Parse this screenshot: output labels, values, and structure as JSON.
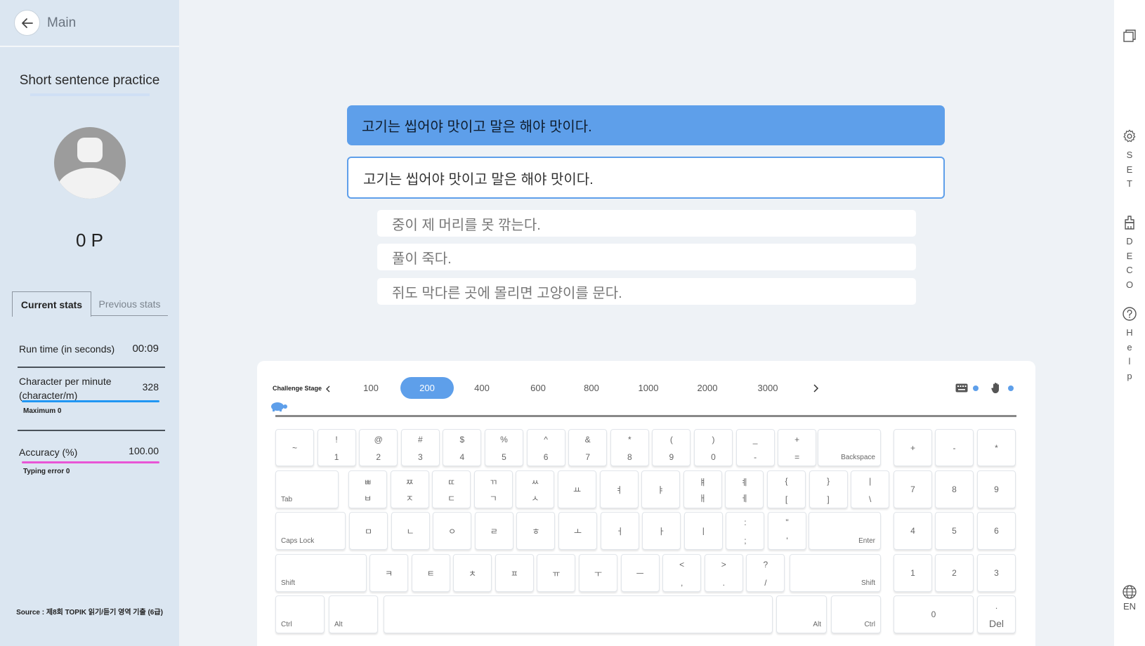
{
  "header": {
    "back_label": "Main"
  },
  "mode": {
    "title": "Short sentence practice"
  },
  "user": {
    "points": "0 P"
  },
  "stats": {
    "tabs": [
      "Current stats",
      "Previous stats"
    ],
    "run_time_label": "Run time (in seconds)",
    "run_time_value": "00:09",
    "cpm_label": "Character per minute (character/m)",
    "cpm_value": "328",
    "cpm_max": "Maximum 0",
    "cpm_color": "#2196f3",
    "accuracy_label": "Accuracy (%)",
    "accuracy_value": "100.00",
    "accuracy_error": "Typing error 0",
    "accuracy_color": "#e855d6"
  },
  "source": {
    "text": "Source : 제8회 TOPIK 읽기/듣기 영역 기출 (6급)"
  },
  "right_menu": {
    "set_letters": "S\nE\nT",
    "deco_letters": "D\nE\nC\nO",
    "help_letters": "H\ne\nl\np",
    "lang": "EN"
  },
  "sentences": {
    "current": "고기는 씹어야 맛이고 말은 해야 맛이다.",
    "typed": "고기는 씹어야 맛이고 말은 해야 맛이다.",
    "next": [
      "중이 제 머리를 못 깎는다.",
      "풀이 죽다.",
      "쥐도 막다른 곳에 몰리면 고양이를 문다."
    ]
  },
  "stage": {
    "label": "Challenge Stage",
    "options": [
      "100",
      "200",
      "400",
      "600",
      "800",
      "1000",
      "2000",
      "3000"
    ],
    "selected": "200"
  },
  "keyboard": {
    "row1": [
      [
        "~",
        ""
      ],
      [
        "!",
        "1"
      ],
      [
        "@",
        "2"
      ],
      [
        "#",
        "3"
      ],
      [
        "$",
        "4"
      ],
      [
        "%",
        "5"
      ],
      [
        "^",
        "6"
      ],
      [
        "&",
        "7"
      ],
      [
        "*",
        "8"
      ],
      [
        "(",
        "9"
      ],
      [
        ")",
        "0"
      ],
      [
        "_",
        "-"
      ],
      [
        "+",
        "="
      ]
    ],
    "backspace": "Backspace",
    "tab": "Tab",
    "row2": [
      [
        "ㅃ",
        "ㅂ"
      ],
      [
        "ㅉ",
        "ㅈ"
      ],
      [
        "ㄸ",
        "ㄷ"
      ],
      [
        "ㄲ",
        "ㄱ"
      ],
      [
        "ㅆ",
        "ㅅ"
      ],
      [
        "",
        "ㅛ"
      ],
      [
        "",
        "ㅕ"
      ],
      [
        "",
        "ㅑ"
      ],
      [
        "ㅒ",
        "ㅐ"
      ],
      [
        "ㅖ",
        "ㅔ"
      ],
      [
        "{",
        "["
      ],
      [
        "}",
        "]"
      ],
      [
        "|",
        "\\"
      ]
    ],
    "caps": "Caps Lock",
    "row3": [
      [
        "",
        "ㅁ"
      ],
      [
        "",
        "ㄴ"
      ],
      [
        "",
        "ㅇ"
      ],
      [
        "",
        "ㄹ"
      ],
      [
        "",
        "ㅎ"
      ],
      [
        "",
        "ㅗ"
      ],
      [
        "",
        "ㅓ"
      ],
      [
        "",
        "ㅏ"
      ],
      [
        "",
        "ㅣ"
      ],
      [
        ":",
        ";"
      ],
      [
        "\"",
        "'"
      ]
    ],
    "enter": "Enter",
    "shift": "Shift",
    "row4": [
      [
        "",
        "ㅋ"
      ],
      [
        "",
        "ㅌ"
      ],
      [
        "",
        "ㅊ"
      ],
      [
        "",
        "ㅍ"
      ],
      [
        "",
        "ㅠ"
      ],
      [
        "",
        "ㅜ"
      ],
      [
        "",
        "ㅡ"
      ],
      [
        "<",
        ","
      ],
      [
        ">",
        "."
      ],
      [
        "?",
        "/"
      ]
    ],
    "ctrl": "Ctrl",
    "alt": "Alt",
    "numpad": [
      "+",
      "-",
      "*",
      "7",
      "8",
      "9",
      "4",
      "5",
      "6",
      "1",
      "2",
      "3",
      "0"
    ],
    "del_top": ".",
    "del": "Del"
  }
}
